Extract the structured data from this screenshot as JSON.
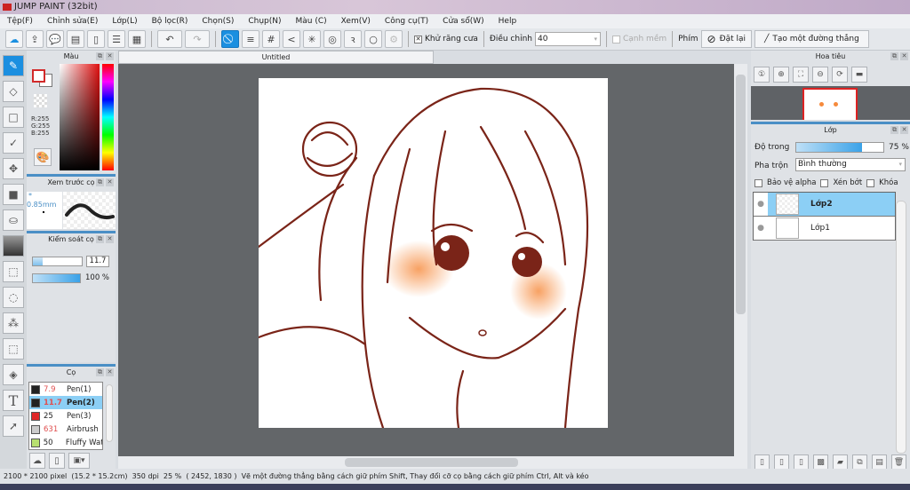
{
  "window": {
    "title": "JUMP PAINT (32bit)"
  },
  "menu": [
    "Tệp(F)",
    "Chỉnh sửa(E)",
    "Lớp(L)",
    "Bộ lọc(R)",
    "Chọn(S)",
    "Chụp(N)",
    "Màu (C)",
    "Xem(V)",
    "Công cụ(T)",
    "Cửa sổ(W)",
    "Help"
  ],
  "toolbar": {
    "antialias_label": "Khử răng cưa",
    "adjust_label": "Điều chỉnh",
    "adjust_value": "40",
    "soft_edge_label": "Cạnh mềm",
    "key_label": "Phím",
    "reset_label": "Đặt lại",
    "straight_line_label": "Tạo một đường thẳng"
  },
  "color_panel": {
    "title": "Màu",
    "r": "R:255",
    "g": "G:255",
    "b": "B:255",
    "primary": "#ffffff",
    "accent": "#d22a2a"
  },
  "brush_preview": {
    "title": "Xem trước cọ",
    "size": "* 0.85mm"
  },
  "brush_control": {
    "title": "Kiểm soát cọ",
    "size_value": "11.7",
    "opacity_value": "100 %",
    "size_fraction": 0.2,
    "opacity_fraction": 1.0
  },
  "brushes": {
    "title": "Cọ",
    "items": [
      {
        "size": "7.9",
        "name": "Pen(1)",
        "color": "#222222",
        "selected": false
      },
      {
        "size": "11.7",
        "name": "Pen(2)",
        "color": "#222222",
        "selected": true
      },
      {
        "size": "25",
        "name": "Pen(3)",
        "color": "#e02828",
        "selected": false
      },
      {
        "size": "631",
        "name": "Airbrush",
        "color": "#cccccc",
        "selected": false
      },
      {
        "size": "50",
        "name": "Fluffy Wat",
        "color": "#b8e070",
        "selected": false
      }
    ]
  },
  "document": {
    "tab": "Untitled"
  },
  "navigator": {
    "title": "Hoa tiêu"
  },
  "layers": {
    "title": "Lớp",
    "opacity_label": "Độ trong",
    "opacity_value": "75 %",
    "opacity_fraction": 0.75,
    "blend_label": "Pha trộn",
    "blend_value": "Bình thường",
    "protect_alpha": "Bảo vệ alpha",
    "clip": "Xén bớt",
    "lock": "Khóa",
    "items": [
      {
        "name": "Lớp2",
        "selected": true
      },
      {
        "name": "Lớp1",
        "selected": false
      }
    ]
  },
  "status": {
    "size": "2100 * 2100 pixel",
    "cm": "(15.2 * 15.2cm)",
    "dpi": "350 dpi",
    "zoom": "25 %",
    "coords": "( 2452, 1830 )",
    "hint": "Vẽ một đường thẳng bằng cách giữ phím Shift, Thay đổi cỡ cọ bằng cách giữ phím Ctrl, Alt và kéo"
  }
}
